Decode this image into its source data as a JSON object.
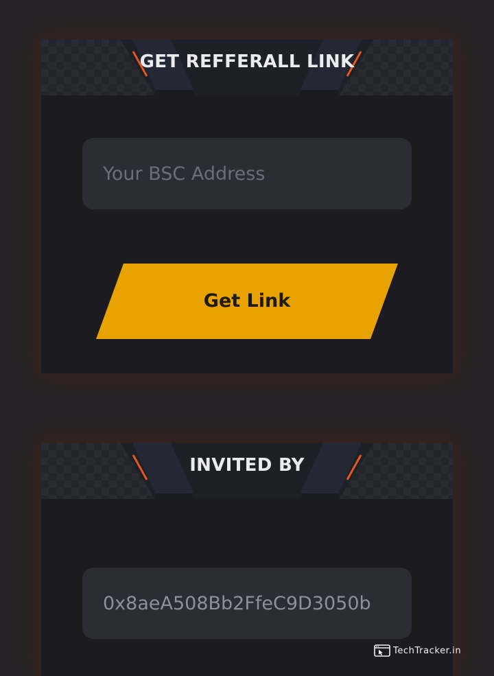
{
  "referral": {
    "title": "GET REFFERALL LINK",
    "address_placeholder": "Your BSC Address",
    "address_value": "",
    "button_label": "Get Link"
  },
  "invited": {
    "title": "INVITED BY",
    "address_value": "0x8aeA508Bb2FfeC9D3050b"
  },
  "watermark": {
    "icon": "browser-cursor-icon",
    "text": "TechTracker.in"
  },
  "colors": {
    "background": "#262428",
    "panel": "#1c1c20",
    "header_tab": "#23252d",
    "accent_orange": "#e5571f",
    "button_yellow": "#e8a202",
    "field": "#2b2c34"
  }
}
